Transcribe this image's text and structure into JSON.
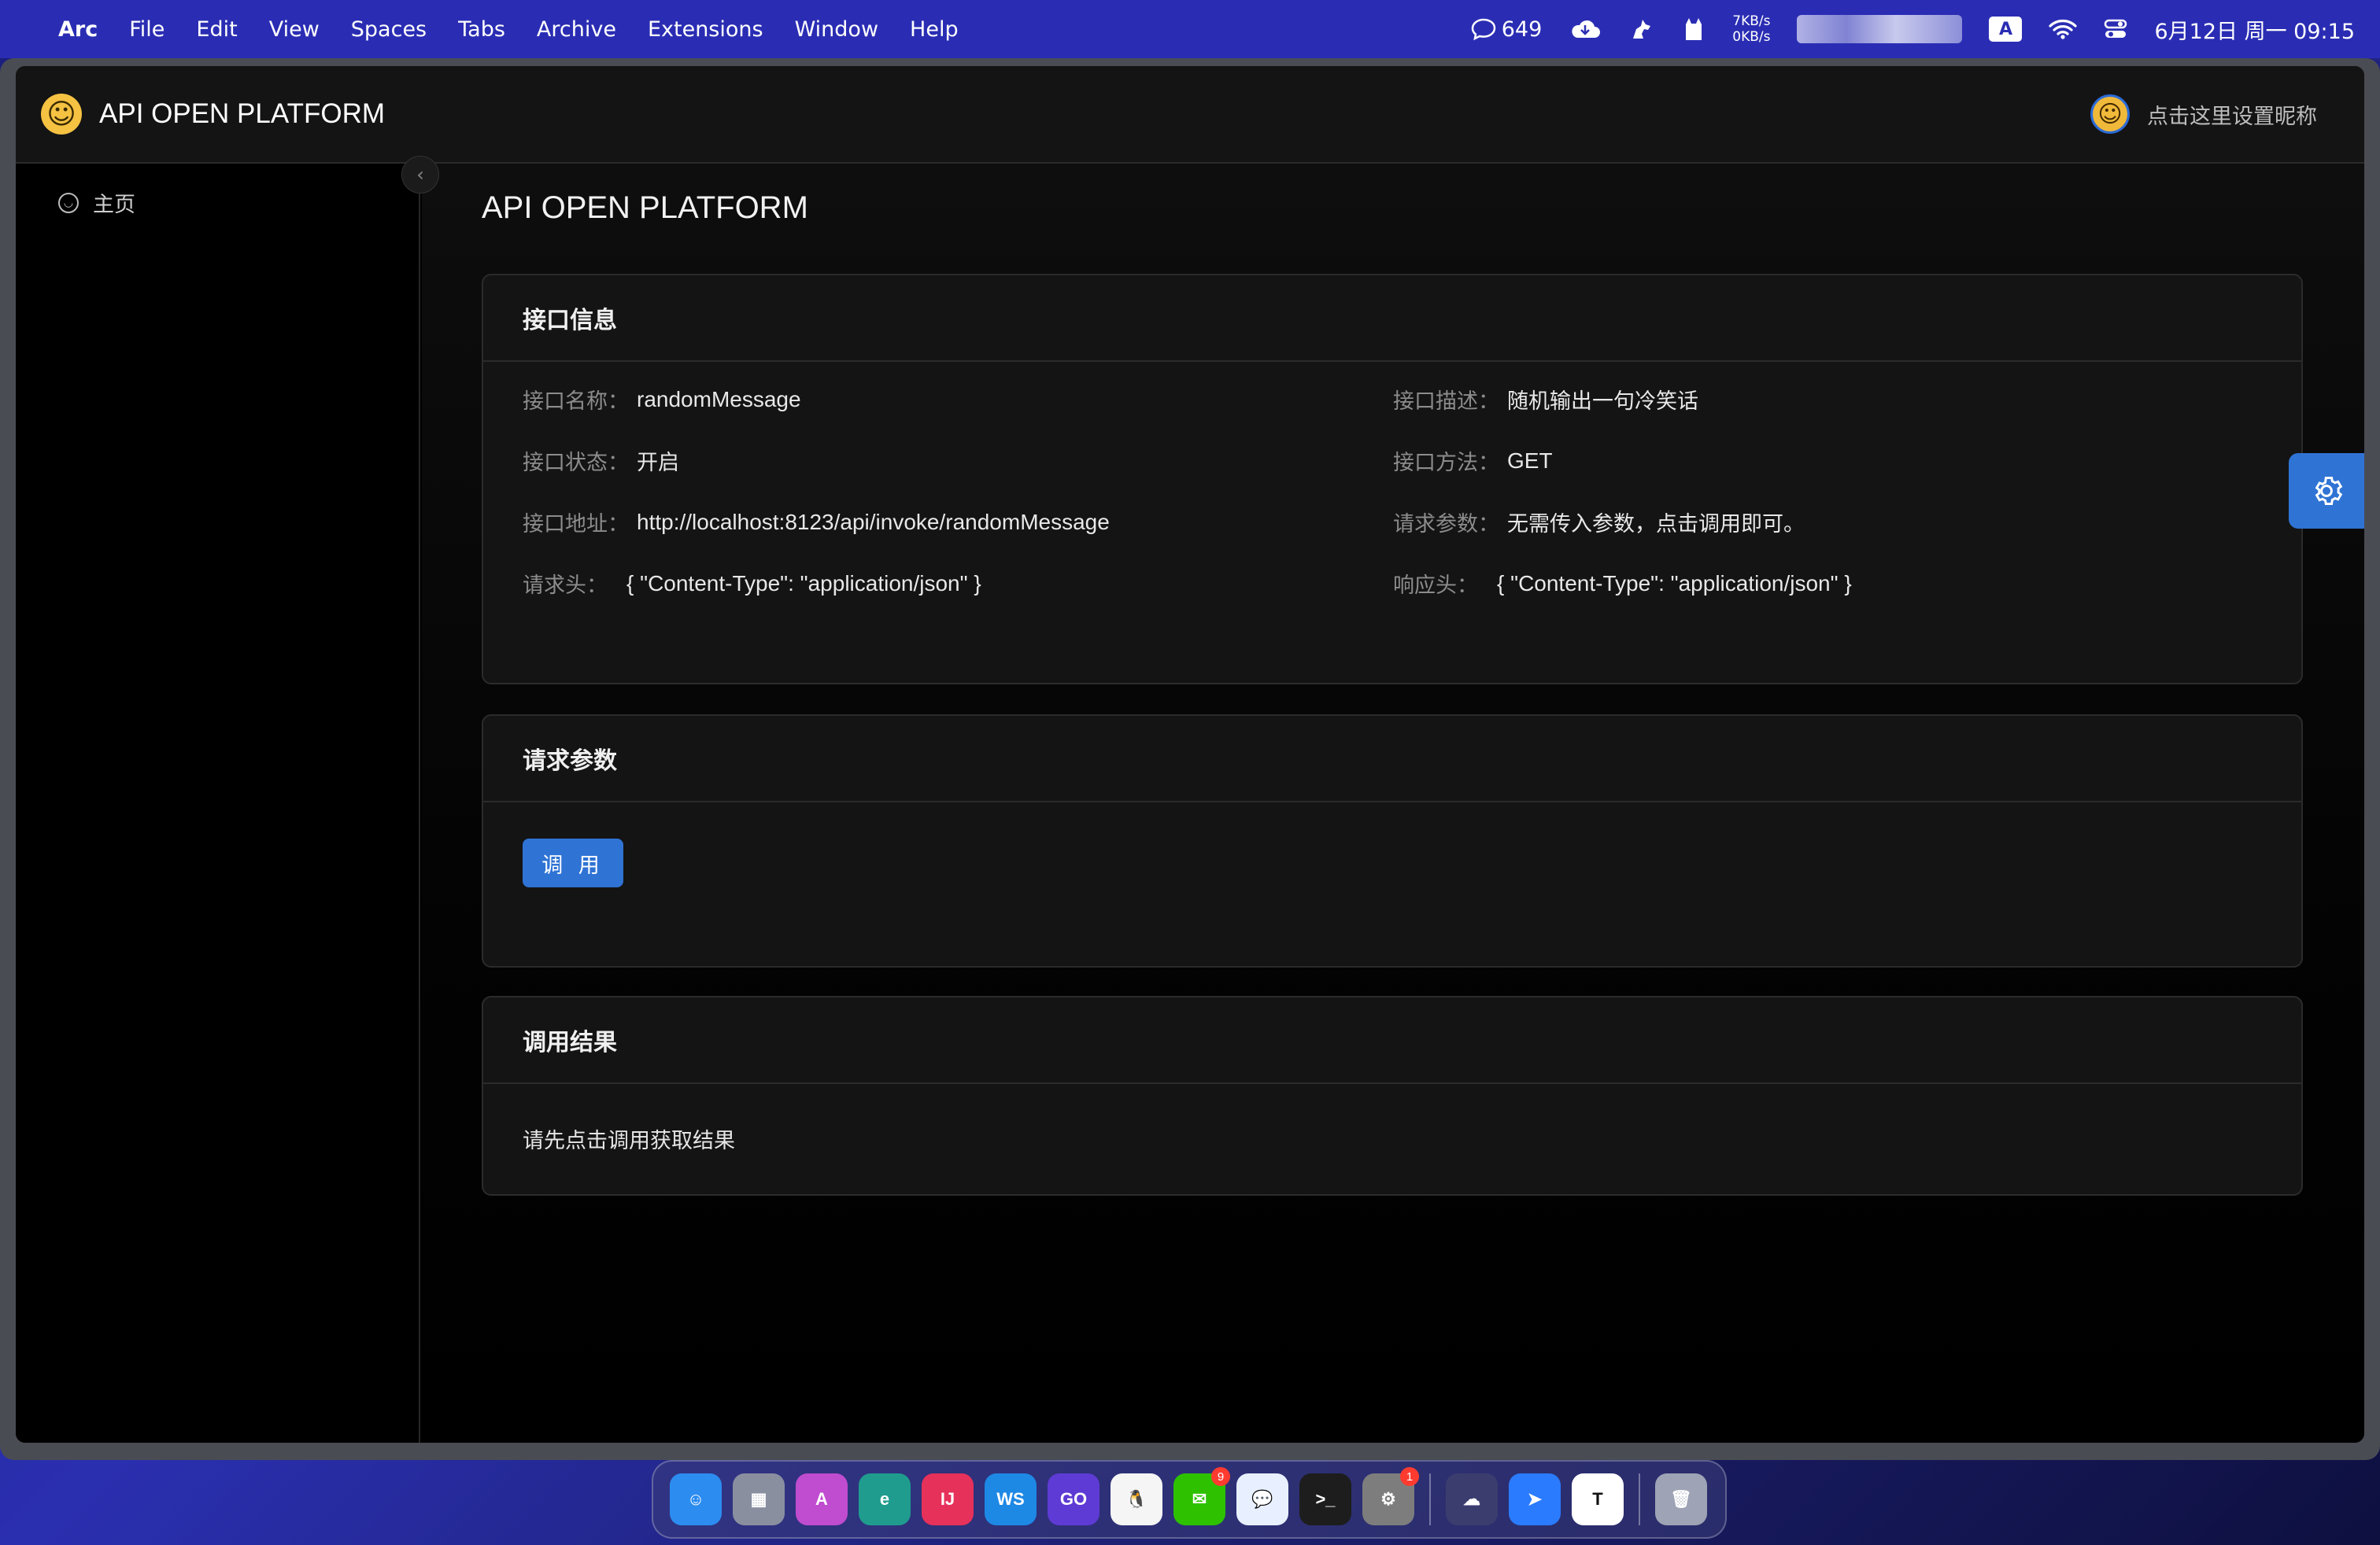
{
  "menubar": {
    "apple_icon": "apple-logo-icon",
    "app_name": "Arc",
    "menus": [
      "File",
      "Edit",
      "View",
      "Spaces",
      "Tabs",
      "Archive",
      "Extensions",
      "Window",
      "Help"
    ],
    "chat_count": "649",
    "net_up": "7KB/s",
    "net_down": "0KB/s",
    "input_method": "A",
    "clock": "6月12日 周一  09:15"
  },
  "app": {
    "brand_title": "API OPEN PLATFORM",
    "nickname": "点击这里设置昵称"
  },
  "sidebar": {
    "items": [
      {
        "label": "主页",
        "icon": "smile-icon"
      }
    ],
    "collapse_icon": "chevron-left-icon"
  },
  "page": {
    "title": "API OPEN PLATFORM"
  },
  "interface_info": {
    "title": "接口信息",
    "fields": {
      "name": {
        "label": "接口名称：",
        "value": "randomMessage"
      },
      "description": {
        "label": "接口描述：",
        "value": "随机输出一句冷笑话"
      },
      "status": {
        "label": "接口状态：",
        "value": "开启"
      },
      "method": {
        "label": "接口方法：",
        "value": "GET"
      },
      "url": {
        "label": "接口地址：",
        "value": "http://localhost:8123/api/invoke/randomMessage"
      },
      "request_params": {
        "label": "请求参数：",
        "value": "无需传入参数，点击调用即可。"
      },
      "request_header": {
        "label": "请求头：",
        "value": "{ \"Content-Type\": \"application/json\" }"
      },
      "response_header": {
        "label": "响应头：",
        "value": "{ \"Content-Type\": \"application/json\" }"
      }
    }
  },
  "request_section": {
    "title": "请求参数",
    "invoke_label": "调 用"
  },
  "result_section": {
    "title": "调用结果",
    "placeholder": "请先点击调用获取结果"
  },
  "dock": {
    "apps": [
      {
        "name": "Finder",
        "icon": "finder-icon",
        "color": "#2d8cf0",
        "glyph": "☺"
      },
      {
        "name": "Launchpad",
        "icon": "launchpad-icon",
        "color": "#8a8fa0",
        "glyph": "▦"
      },
      {
        "name": "Arc",
        "icon": "arc-icon",
        "color": "#c04ccf",
        "glyph": "A"
      },
      {
        "name": "Edge Dev",
        "icon": "edge-dev-icon",
        "color": "#1f9c8e",
        "glyph": "e"
      },
      {
        "name": "IntelliJ IDEA",
        "icon": "intellij-icon",
        "color": "#e6315a",
        "glyph": "IJ"
      },
      {
        "name": "WebStorm",
        "icon": "webstorm-icon",
        "color": "#1e88e5",
        "glyph": "WS"
      },
      {
        "name": "GoLand",
        "icon": "goland-icon",
        "color": "#5e3bd4",
        "glyph": "GO"
      },
      {
        "name": "QQ",
        "icon": "qq-penguin-icon",
        "color": "#f5f5f5",
        "glyph": "🐧"
      },
      {
        "name": "WeChat",
        "icon": "wechat-icon",
        "color": "#2dc100",
        "glyph": "✉",
        "badge": "9"
      },
      {
        "name": "Chat",
        "icon": "chat-bubble-icon",
        "color": "#e8f0ff",
        "glyph": "💬"
      },
      {
        "name": "Terminal",
        "icon": "terminal-icon",
        "color": "#1d1d1d",
        "glyph": ">_"
      },
      {
        "name": "System Settings",
        "icon": "system-settings-icon",
        "color": "#7d7d7d",
        "glyph": "⚙",
        "badge": "1"
      },
      {
        "name": "Cloud",
        "icon": "cloud-icon",
        "color": "#3b3d6e",
        "glyph": "☁"
      },
      {
        "name": "Feishu",
        "icon": "feishu-icon",
        "color": "#2b7bff",
        "glyph": "➤"
      },
      {
        "name": "Typora",
        "icon": "typora-icon",
        "color": "#ffffff",
        "glyph": "T"
      },
      {
        "name": "Trash",
        "icon": "trash-icon",
        "color": "#9ea3b5",
        "glyph": "🗑"
      }
    ]
  }
}
